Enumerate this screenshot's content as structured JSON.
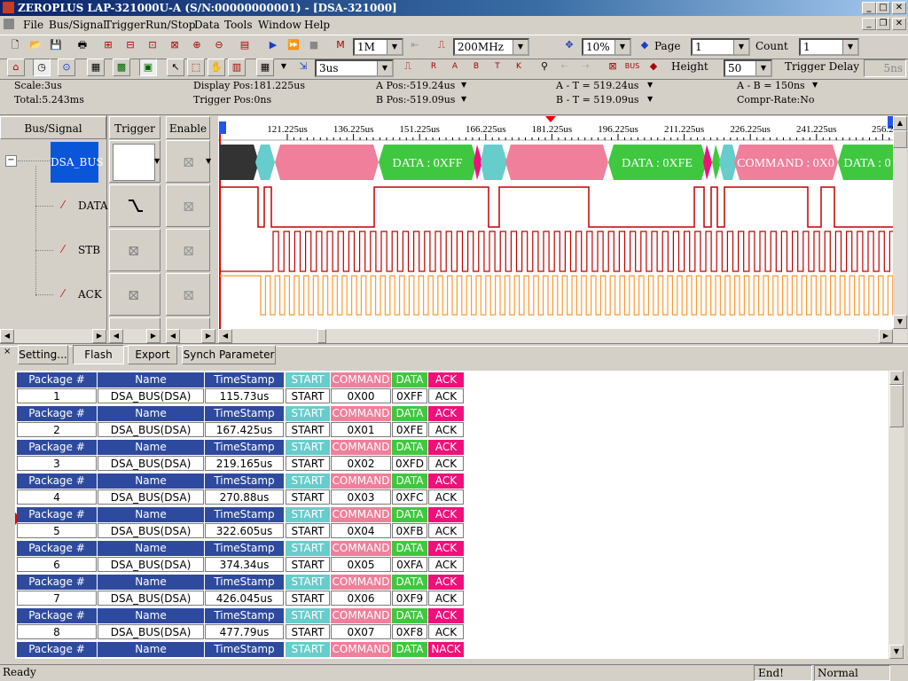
{
  "window": {
    "title": "ZEROPLUS LAP-321000U-A (S/N:00000000001) - [DSA-321000]"
  },
  "menu": [
    "File",
    "Bus/Signal",
    "Trigger",
    "Run/Stop",
    "Data",
    "Tools",
    "Window",
    "Help"
  ],
  "toolbar1": {
    "memory": "1M",
    "clock": "200MHz",
    "zoom": "10%",
    "page_label": "Page",
    "page_value": "1",
    "count_label": "Count",
    "count_value": "1"
  },
  "toolbar2": {
    "timescale": "3us",
    "height_label": "Height",
    "height_value": "50",
    "trigger_delay_label": "Trigger Delay",
    "trigger_delay_value": "5ns"
  },
  "info": {
    "scale": "Scale:3us",
    "total": "Total:5.243ms",
    "display_pos": "Display Pos:181.225us",
    "trigger_pos": "Trigger Pos:0ns",
    "a_pos": "A Pos:-519.24us",
    "b_pos": "B Pos:-519.09us",
    "a_t": "A - T = 519.24us",
    "b_t": "B - T = 519.09us",
    "a_b": "A - B = 150ns",
    "compr": "Compr-Rate:No"
  },
  "panel_headers": {
    "bus_signal": "Bus/Signal",
    "trigger": "Trigger",
    "enable": "Enable"
  },
  "signals": {
    "bus": "DSA_BUS",
    "data": "DATA",
    "stb": "STB",
    "ack": "ACK"
  },
  "time_ticks": [
    "121.225us",
    "136.225us",
    "151.225us",
    "166.225us",
    "181.225us",
    "196.225us",
    "211.225us",
    "226.225us",
    "241.225us",
    "256.2"
  ],
  "bus_labels": [
    "DATA : 0XFF",
    "DATA : 0XFE",
    "COMMAND : 0X0",
    "DATA : 0"
  ],
  "buttons": {
    "setting": "Setting...",
    "flash": "Flash",
    "export": "Export",
    "synch": "Synch Parameter"
  },
  "packet_headers": {
    "package": "Package #",
    "name": "Name",
    "timestamp": "TimeStamp",
    "start": "START",
    "command": "COMMAND",
    "data": "DATA",
    "ack": "ACK",
    "nack": "NACK"
  },
  "packets": [
    {
      "num": "1",
      "name": "DSA_BUS(DSA)",
      "ts": "115.73us",
      "start": "START",
      "cmd": "0X00",
      "data": "0XFF",
      "ack": "ACK"
    },
    {
      "num": "2",
      "name": "DSA_BUS(DSA)",
      "ts": "167.425us",
      "start": "START",
      "cmd": "0X01",
      "data": "0XFE",
      "ack": "ACK"
    },
    {
      "num": "3",
      "name": "DSA_BUS(DSA)",
      "ts": "219.165us",
      "start": "START",
      "cmd": "0X02",
      "data": "0XFD",
      "ack": "ACK"
    },
    {
      "num": "4",
      "name": "DSA_BUS(DSA)",
      "ts": "270.88us",
      "start": "START",
      "cmd": "0X03",
      "data": "0XFC",
      "ack": "ACK"
    },
    {
      "num": "5",
      "name": "DSA_BUS(DSA)",
      "ts": "322.605us",
      "start": "START",
      "cmd": "0X04",
      "data": "0XFB",
      "ack": "ACK"
    },
    {
      "num": "6",
      "name": "DSA_BUS(DSA)",
      "ts": "374.34us",
      "start": "START",
      "cmd": "0X05",
      "data": "0XFA",
      "ack": "ACK"
    },
    {
      "num": "7",
      "name": "DSA_BUS(DSA)",
      "ts": "426.045us",
      "start": "START",
      "cmd": "0X06",
      "data": "0XF9",
      "ack": "ACK"
    },
    {
      "num": "8",
      "name": "DSA_BUS(DSA)",
      "ts": "477.79us",
      "start": "START",
      "cmd": "0X07",
      "data": "0XF8",
      "ack": "ACK"
    }
  ],
  "status": {
    "ready": "Ready",
    "end": "End!",
    "mode": "Normal"
  },
  "colors": {
    "start": "#66cccc",
    "command": "#ef7f9a",
    "data": "#3fc83f",
    "ack": "#f0107a",
    "header": "#2e4a9e",
    "bus_dark": "#333333",
    "signal": "#c00000",
    "ack_line": "#ff9933"
  }
}
